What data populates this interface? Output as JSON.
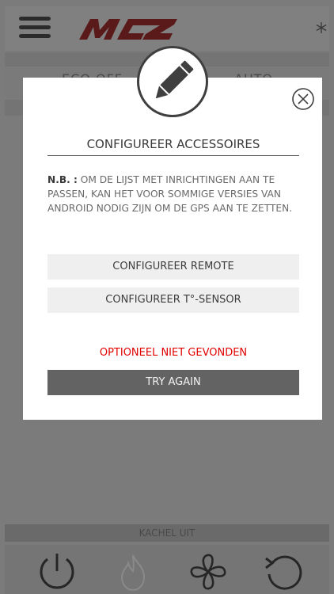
{
  "app": {
    "logo_text": "MCZ",
    "mode_left": "ECO OFF",
    "mode_right": "AUTO",
    "status": "KACHEL UIT"
  },
  "modal": {
    "title": "CONFIGUREER ACCESSOIRES",
    "note_prefix": "N.B. :",
    "note_text": " OM DE LIJST MET INRICHTINGEN AAN TE PASSEN, KAN HET VOOR SOMMIGE VERSIES VAN ANDROID NODIG ZIJN OM DE GPS AAN TE ZETTEN.",
    "button_remote": "CONFIGUREER REMOTE",
    "button_sensor": "CONFIGUREER T°-SENSOR",
    "error": "OPTIONEEL NIET GEVONDEN",
    "button_retry": "TRY AGAIN"
  },
  "icons": {
    "menu": "hamburger-menu-icon",
    "snow": "snowflake-icon",
    "edit": "pencil-icon",
    "close": "close-circle-icon",
    "power": "power-icon",
    "flame": "flame-icon",
    "fan": "fan-icon",
    "refresh": "refresh-icon"
  },
  "colors": {
    "brand_red": "#c1121f",
    "error_red": "#e00000",
    "retry_button": "#636363"
  }
}
